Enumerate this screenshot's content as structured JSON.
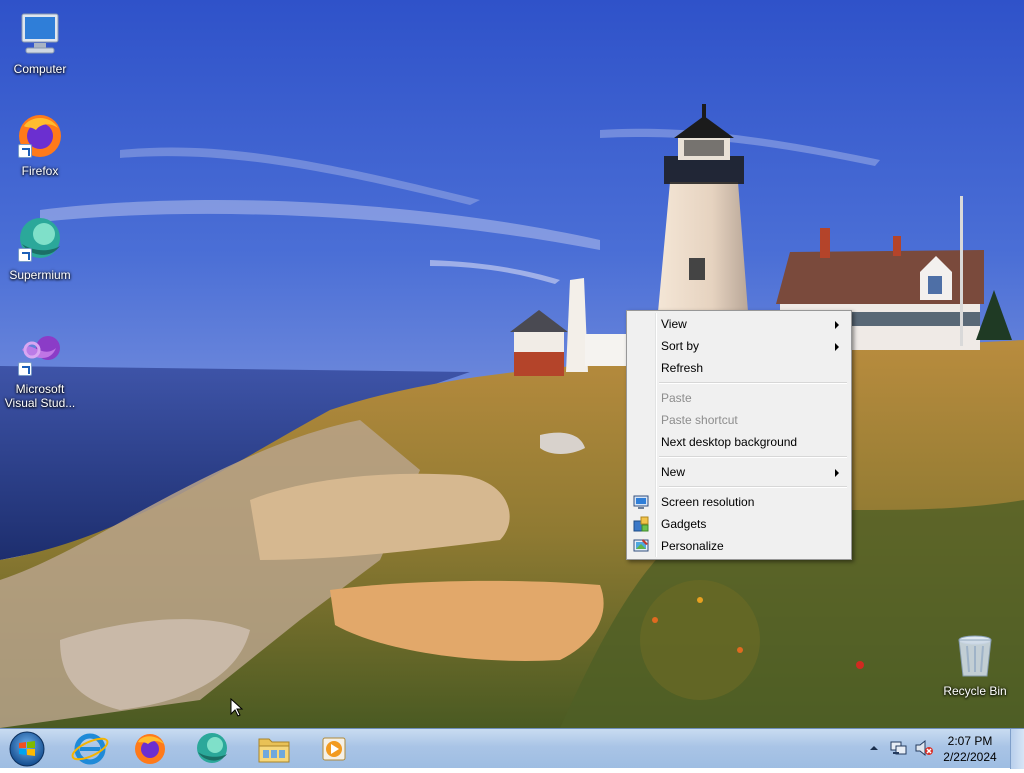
{
  "desktop": {
    "icons": [
      {
        "label": "Computer",
        "icon": "computer-icon"
      },
      {
        "label": "Firefox",
        "icon": "firefox-icon"
      },
      {
        "label": "Supermium",
        "icon": "supermium-icon"
      },
      {
        "label": "Microsoft Visual Stud...",
        "icon": "visual-studio-icon"
      },
      {
        "label": "Recycle Bin",
        "icon": "recycle-bin-icon"
      }
    ]
  },
  "context_menu": {
    "items": [
      {
        "label": "View",
        "submenu": true
      },
      {
        "label": "Sort by",
        "submenu": true
      },
      {
        "label": "Refresh"
      },
      {
        "label": "Paste",
        "disabled": true
      },
      {
        "label": "Paste shortcut",
        "disabled": true
      },
      {
        "label": "Next desktop background"
      },
      {
        "label": "New",
        "submenu": true
      },
      {
        "label": "Screen resolution",
        "icon": "screen-resolution-icon"
      },
      {
        "label": "Gadgets",
        "icon": "gadgets-icon"
      },
      {
        "label": "Personalize",
        "icon": "personalize-icon"
      }
    ]
  },
  "taskbar": {
    "pinned": [
      {
        "name": "start",
        "icon": "windows-start-icon"
      },
      {
        "name": "internet-explorer",
        "icon": "internet-explorer-icon"
      },
      {
        "name": "firefox",
        "icon": "firefox-icon"
      },
      {
        "name": "supermium",
        "icon": "supermium-icon"
      },
      {
        "name": "file-explorer",
        "icon": "folder-icon"
      },
      {
        "name": "media-player",
        "icon": "media-player-icon"
      }
    ],
    "tray": {
      "time": "2:07 PM",
      "date": "2/22/2024",
      "icons": [
        "chevron-up-icon",
        "network-icon",
        "volume-muted-icon"
      ]
    }
  },
  "colors": {
    "taskbar": "#a9c4e6",
    "menu_bg": "#f0f0f0",
    "disabled_text": "#8d8d8d"
  }
}
